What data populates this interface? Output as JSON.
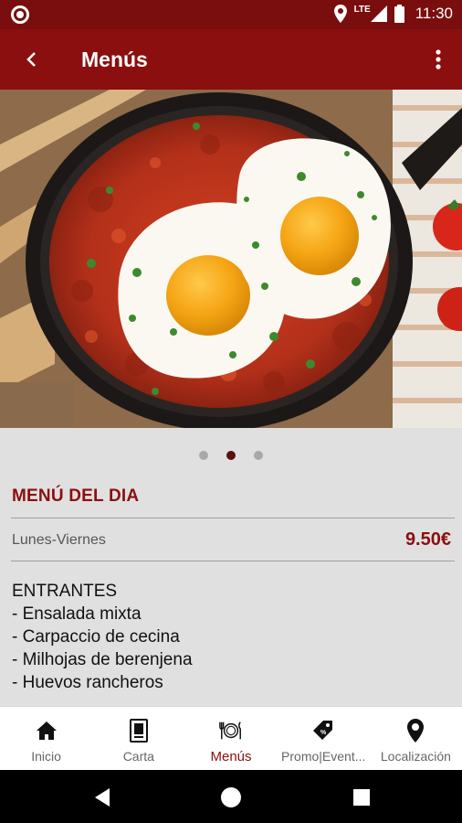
{
  "status_bar": {
    "time": "11:30",
    "network": "LTE"
  },
  "app_bar": {
    "title": "Menús"
  },
  "carousel": {
    "pages": 3,
    "active_index": 1
  },
  "menu": {
    "title": "MENÚ DEL DIA",
    "period": "Lunes-Viernes",
    "price": "9.50€",
    "section_heading": "ENTRANTES",
    "items": [
      "- Ensalada mixta",
      "- Carpaccio de cecina",
      "- Milhojas de berenjena",
      "- Huevos rancheros"
    ]
  },
  "bottom_nav": {
    "items": [
      {
        "label": "Inicio",
        "icon": "home-icon"
      },
      {
        "label": "Carta",
        "icon": "carta-icon"
      },
      {
        "label": "Menús",
        "icon": "cutlery-plate-icon",
        "active": true
      },
      {
        "label": "Promo|Event...",
        "icon": "promo-tag-icon"
      },
      {
        "label": "Localización",
        "icon": "location-pin-icon"
      }
    ]
  },
  "colors": {
    "brand": "#8b0f0f",
    "status_bar": "#7a0e0e"
  }
}
